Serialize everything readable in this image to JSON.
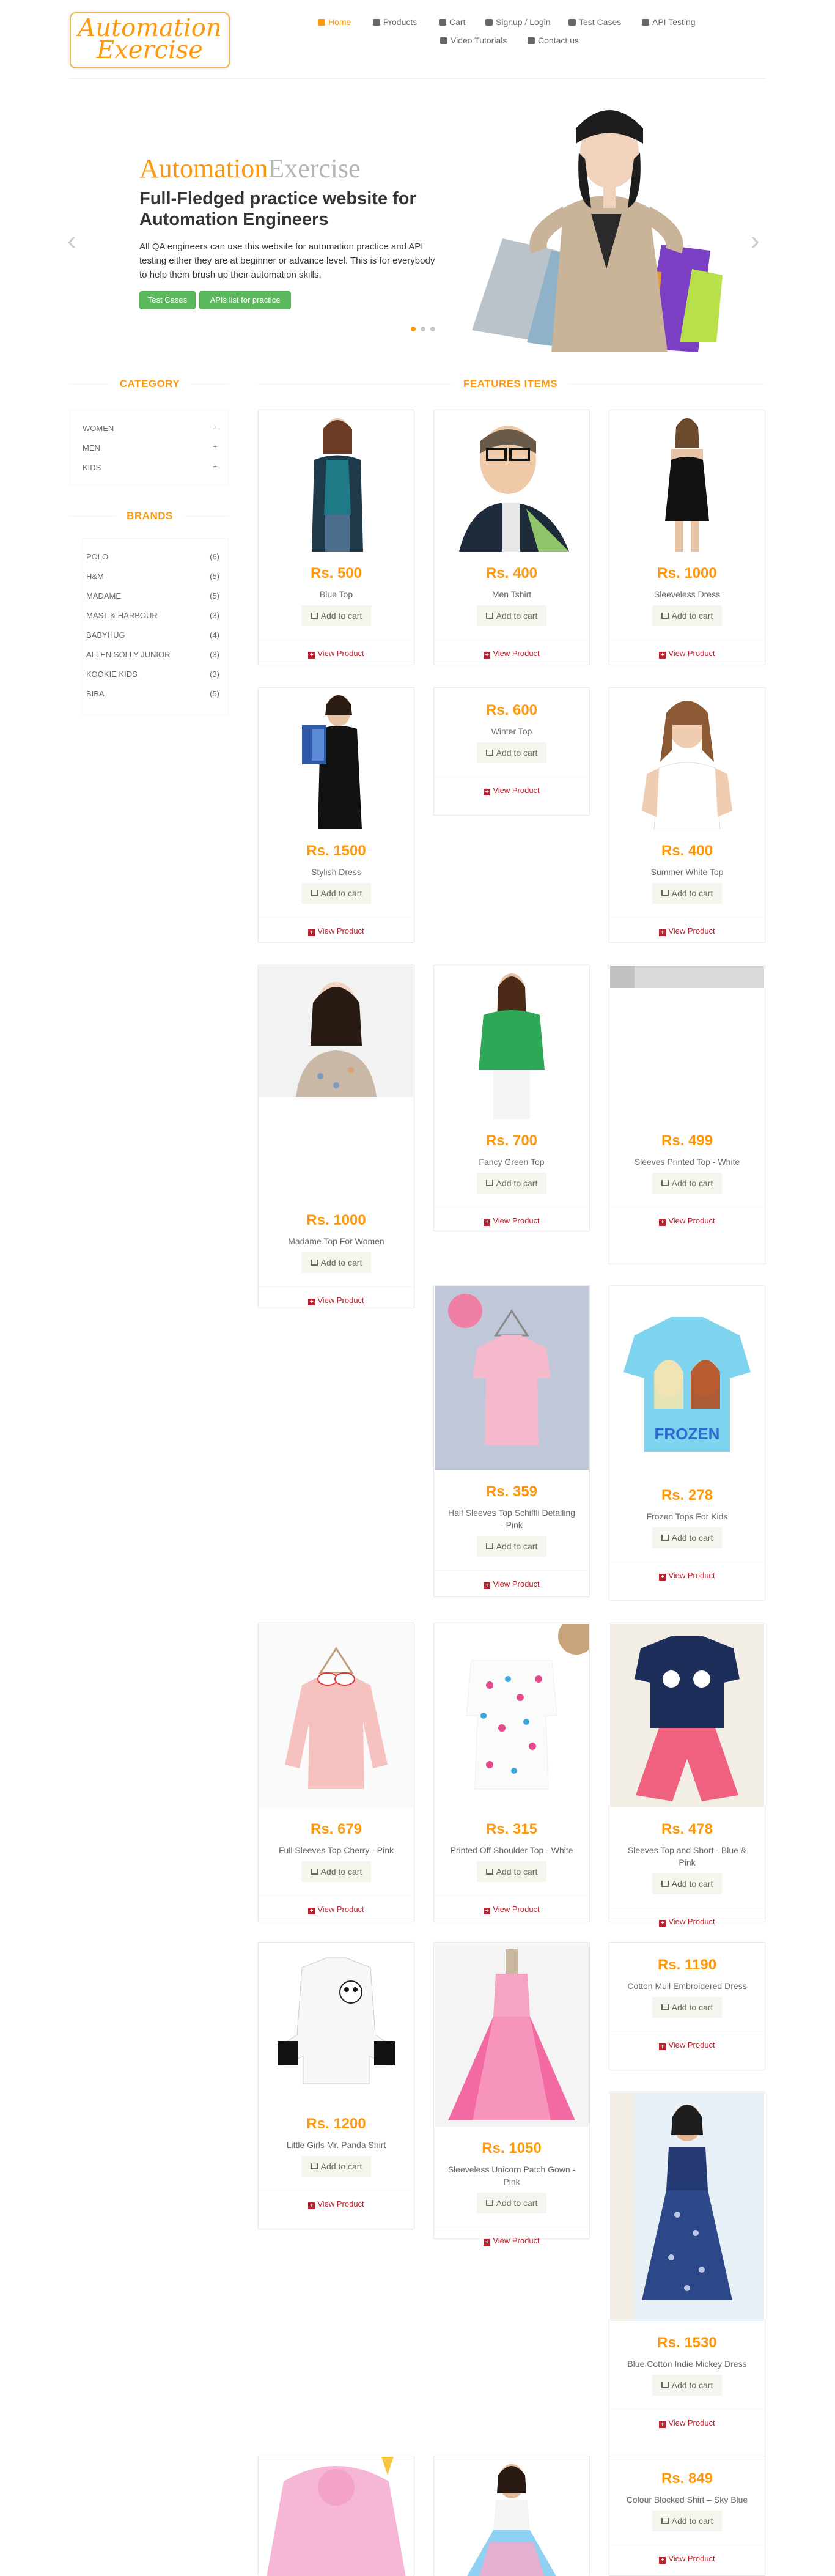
{
  "header": {
    "logo_line1": "Automation",
    "logo_line2": "Exercise",
    "nav": [
      {
        "label": "Home",
        "icon": "home-icon"
      },
      {
        "label": "Products",
        "icon": "products-icon"
      },
      {
        "label": "Cart",
        "icon": "cart-icon"
      },
      {
        "label": "Signup / Login",
        "icon": "lock-icon"
      },
      {
        "label": "Test Cases",
        "icon": "list-icon"
      },
      {
        "label": "API Testing",
        "icon": "list-icon"
      },
      {
        "label": "Video Tutorials",
        "icon": "youtube-icon"
      },
      {
        "label": "Contact us",
        "icon": "envelope-icon"
      }
    ]
  },
  "slider": {
    "title_orange": "Automation",
    "title_grey": "Exercise",
    "subtitle": "Full-Fledged practice website for Automation Engineers",
    "description": "All QA engineers can use this website for automation practice and API testing either they are at beginner or advance level. This is for everybody to help them brush up their automation skills.",
    "btn_test_cases": "Test Cases",
    "btn_apis": "APIs list for practice",
    "prev": "‹",
    "next": "›"
  },
  "sidebar": {
    "category_title": "CATEGORY",
    "categories": [
      "WOMEN",
      "MEN",
      "KIDS"
    ],
    "plus": "+",
    "brands_title": "BRANDS",
    "brands": [
      {
        "name": "POLO",
        "count": "(6)"
      },
      {
        "name": "H&M",
        "count": "(5)"
      },
      {
        "name": "MADAME",
        "count": "(5)"
      },
      {
        "name": "MAST & HARBOUR",
        "count": "(3)"
      },
      {
        "name": "BABYHUG",
        "count": "(4)"
      },
      {
        "name": "ALLEN SOLLY JUNIOR",
        "count": "(3)"
      },
      {
        "name": "KOOKIE KIDS",
        "count": "(3)"
      },
      {
        "name": "BIBA",
        "count": "(5)"
      }
    ]
  },
  "features_title": "FEATURES ITEMS",
  "add_to_cart": "Add to cart",
  "view_product": "View Product",
  "products": [
    {
      "price": "Rs. 500",
      "name": "Blue Top"
    },
    {
      "price": "Rs. 400",
      "name": "Men Tshirt"
    },
    {
      "price": "Rs. 1000",
      "name": "Sleeveless Dress"
    },
    {
      "price": "Rs. 1500",
      "name": "Stylish Dress"
    },
    {
      "price": "Rs. 600",
      "name": "Winter Top"
    },
    {
      "price": "Rs. 400",
      "name": "Summer White Top"
    },
    {
      "price": "Rs. 1000",
      "name": "Madame Top For Women"
    },
    {
      "price": "Rs. 700",
      "name": "Fancy Green Top"
    },
    {
      "price": "Rs. 499",
      "name": "Sleeves Printed Top - White"
    },
    {
      "price": "Rs. 359",
      "name": "Half Sleeves Top Schiffli Detailing - Pink"
    },
    {
      "price": "Rs. 278",
      "name": "Frozen Tops For Kids"
    },
    {
      "price": "Rs. 679",
      "name": "Full Sleeves Top Cherry - Pink"
    },
    {
      "price": "Rs. 315",
      "name": "Printed Off Shoulder Top - White"
    },
    {
      "price": "Rs. 478",
      "name": "Sleeves Top and Short - Blue & Pink"
    },
    {
      "price": "Rs. 1200",
      "name": "Little Girls Mr. Panda Shirt"
    },
    {
      "price": "Rs. 1050",
      "name": "Sleeveless Unicorn Patch Gown - Pink"
    },
    {
      "price": "Rs. 1190",
      "name": "Cotton Mull Embroidered Dress"
    },
    {
      "price": "Rs. 1530",
      "name": "Blue Cotton Indie Mickey Dress"
    },
    {
      "price": "",
      "name": ""
    },
    {
      "price": "",
      "name": ""
    },
    {
      "price": "Rs. 849",
      "name": "Colour Blocked Shirt – Sky Blue"
    }
  ]
}
